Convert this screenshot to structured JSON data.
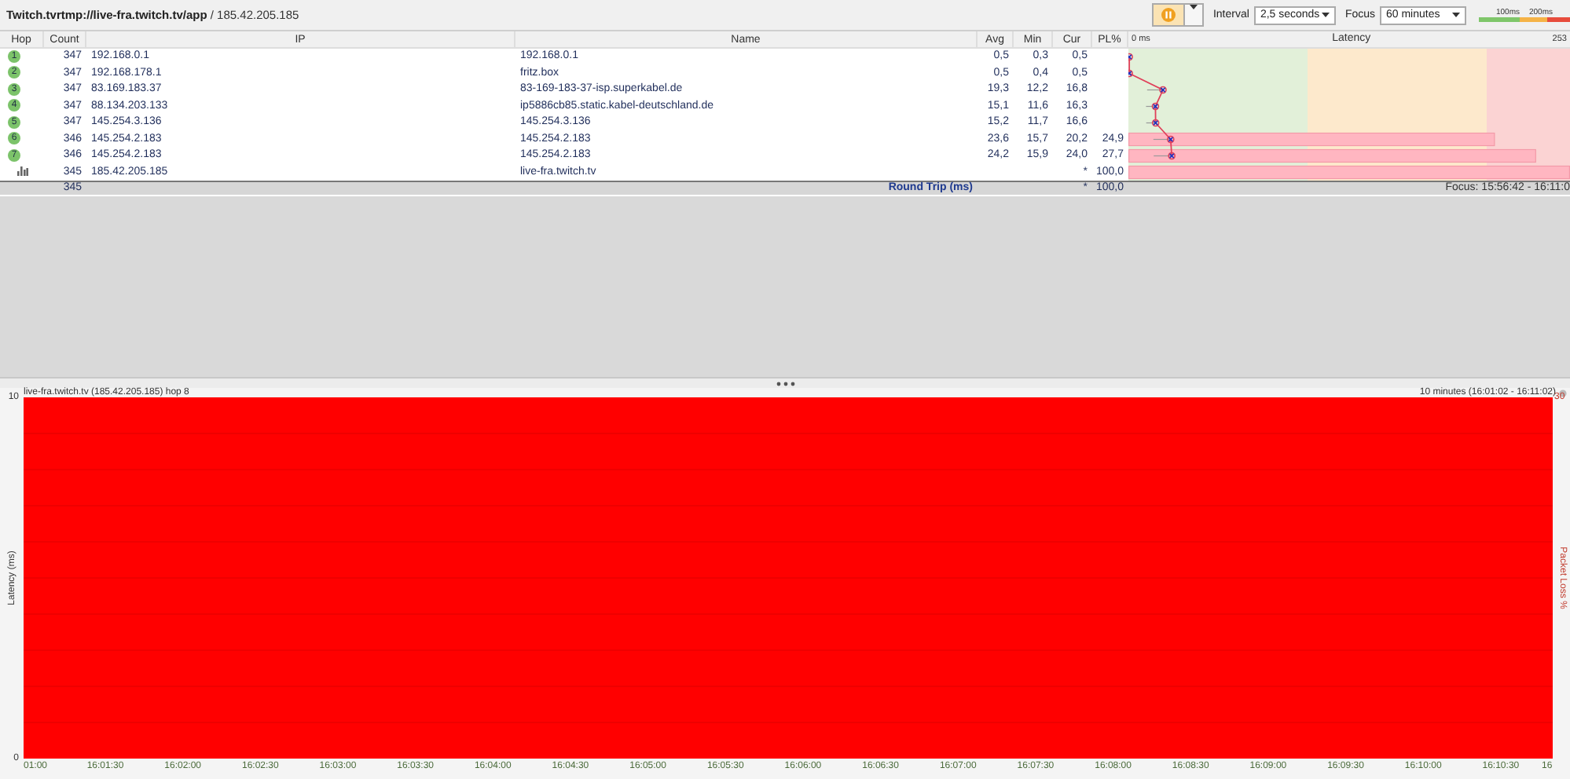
{
  "toolbar": {
    "title_host": "Twitch.tvrtmp://live-fra.twitch.tv/app",
    "title_ip": "/ 185.42.205.185",
    "pause_button": {
      "on": true
    },
    "interval": {
      "label": "Interval",
      "value": "2,5 seconds"
    },
    "focus": {
      "label": "Focus",
      "value": "60 minutes"
    },
    "scale_labels": [
      "100ms",
      "200ms"
    ]
  },
  "table": {
    "columns": [
      "Hop",
      "Count",
      "IP",
      "Name",
      "Avg",
      "Min",
      "Cur",
      "PL%",
      "Latency"
    ],
    "latency_axis": [
      "0 ms",
      "253"
    ],
    "rows": [
      {
        "kind": "hop",
        "hop": "1",
        "count": "347",
        "ip": "192.168.0.1",
        "name": "192.168.0.1",
        "avg": "0,5",
        "min": "0,3",
        "cur": "0,5"
      },
      {
        "kind": "hop",
        "hop": "2",
        "count": "347",
        "ip": "192.168.178.1",
        "name": "fritz.box",
        "avg": "0,5",
        "min": "0,4",
        "cur": "0,5"
      },
      {
        "kind": "hop",
        "hop": "3",
        "count": "347",
        "ip": "83.169.183.37",
        "name": "83-169-183-37-isp.superkabel.de",
        "avg": "19,3",
        "min": "12,2",
        "cur": "16,8"
      },
      {
        "kind": "hop",
        "hop": "4",
        "count": "347",
        "ip": "88.134.203.133",
        "name": "ip5886cb85.static.kabel-deutschland.de",
        "avg": "15,1",
        "min": "11,6",
        "cur": "16,3"
      },
      {
        "kind": "hop",
        "hop": "5",
        "count": "347",
        "ip": "145.254.3.136",
        "name": "145.254.3.136",
        "avg": "15,2",
        "min": "11,7",
        "cur": "16,6"
      },
      {
        "kind": "hop",
        "hop": "6",
        "count": "346",
        "ip": "145.254.2.183",
        "name": "145.254.2.183",
        "avg": "23,6",
        "min": "15,7",
        "cur": "20,2",
        "pl": "24,9"
      },
      {
        "kind": "hop",
        "hop": "7",
        "count": "346",
        "ip": "145.254.2.183",
        "name": "145.254.2.183",
        "avg": "24,2",
        "min": "15,9",
        "cur": "24,0",
        "pl": "27,7"
      },
      {
        "kind": "destination",
        "count": "345",
        "ip": "185.42.205.185",
        "name": "live-fra.twitch.tv",
        "cur": "*",
        "pl": "100,0"
      }
    ],
    "footer": {
      "count": "345",
      "label": "Round Trip (ms)",
      "cur": "*",
      "pl": "100,0",
      "focus": "Focus: 15:56:42 - 16:11:0"
    }
  },
  "graph": {
    "title": "live-fra.twitch.tv (185.42.205.185) hop 8",
    "range": "10 minutes (16:01:02 - 16:11:02)",
    "y_left_max": "10",
    "y_left_min": "0",
    "y_left_label": "Latency (ms)",
    "y_right_max": "30",
    "y_right_label": "Packet Loss %",
    "x_labels": [
      "01:00",
      "16:01:30",
      "16:02:00",
      "16:02:30",
      "16:03:00",
      "16:03:30",
      "16:04:00",
      "16:04:30",
      "16:05:00",
      "16:05:30",
      "16:06:00",
      "16:06:30",
      "16:07:00",
      "16:07:30",
      "16:08:00",
      "16:08:30",
      "16:09:00",
      "16:09:30",
      "16:10:00",
      "16:10:30",
      "16"
    ]
  }
}
